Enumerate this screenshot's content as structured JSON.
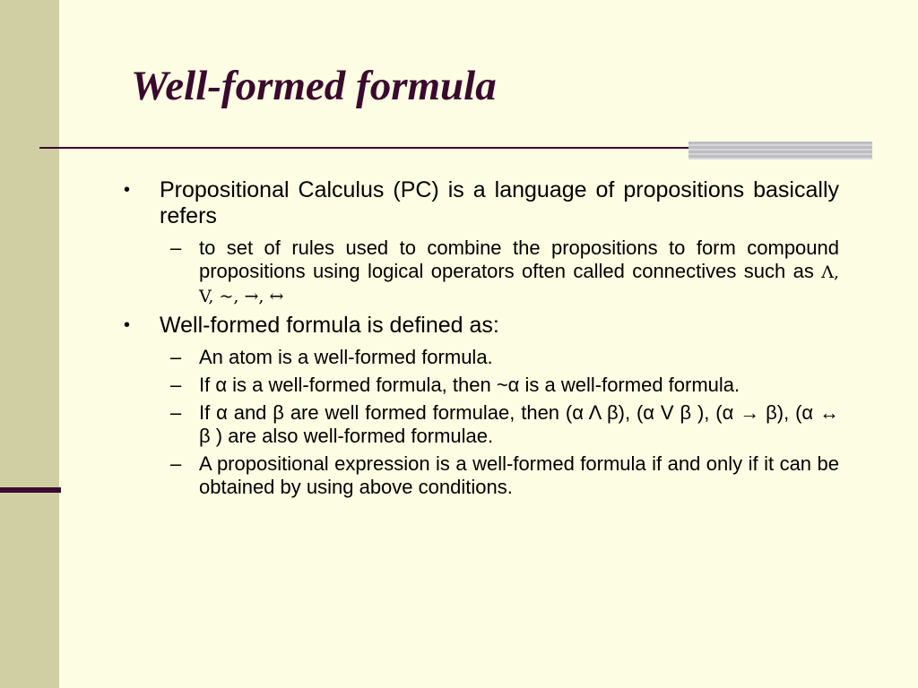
{
  "title": "Well-formed formula",
  "bullet_glyph": "•",
  "dash_glyph": "–",
  "bullets": [
    {
      "text": "Propositional Calculus (PC) is a language of propositions basically refers",
      "subs": [
        {
          "text_a": "to set of rules used  to combine the propositions to form compound propositions using logical operators often called connectives such as ",
          "connectives": "Λ,      V,  ~,  →,  ↔"
        }
      ]
    },
    {
      "text": "Well-formed formula is defined as:",
      "subs": [
        {
          "text": "An atom is a well-formed formula."
        },
        {
          "text": "If  α is a well-formed formula, then ~α is a well-formed formula."
        },
        {
          "text": "If  α and β are well formed formulae, then (α Λ β),  (α  V β ),      (α →  β),      (α ↔ β )  are also well-formed formulae."
        },
        {
          "text": "A propositional expression is a well-formed formula if and only if  it can be obtained by using above conditions."
        }
      ]
    }
  ],
  "colors": {
    "background": "#fdfde3",
    "left_bar": "#cfcfa3",
    "title": "#3a0a2e",
    "rule": "#3a0a2e",
    "rule_block": "#bdbdc2"
  }
}
